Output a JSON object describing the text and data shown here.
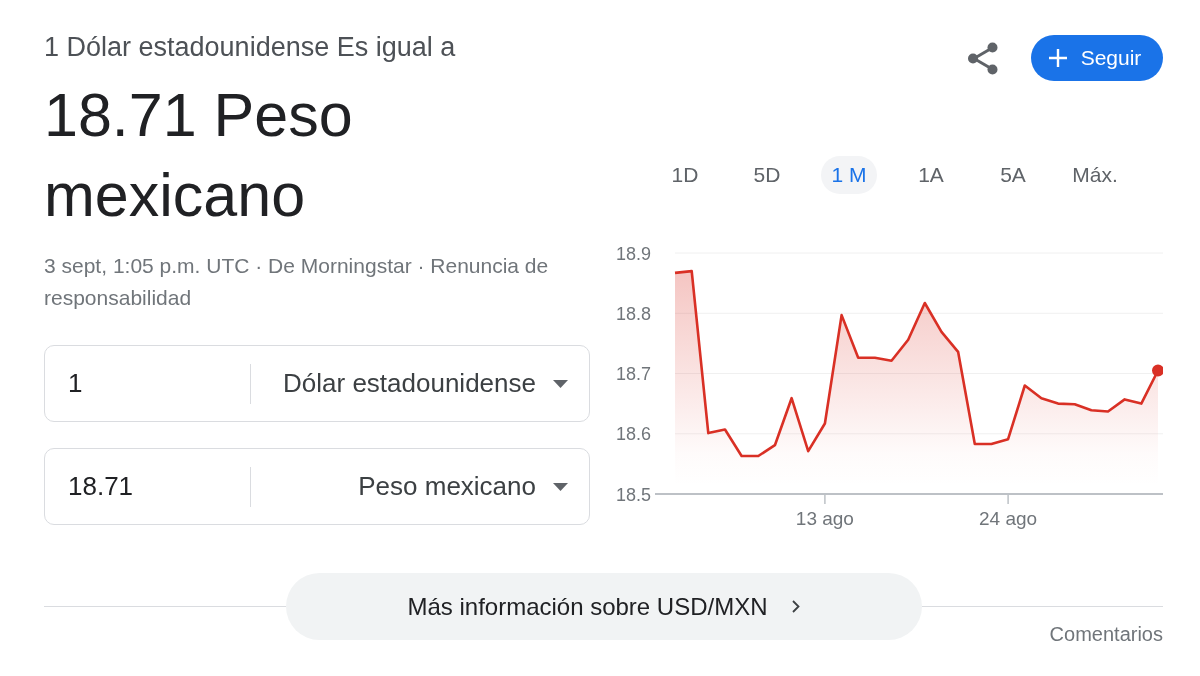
{
  "conversion": {
    "label": "1 Dólar estadounidense Es igual a",
    "result": "18.71 Peso mexicano",
    "note": "3 sept, 1:05 p.m. UTC · De Morningstar · Renuncia de responsabilidad"
  },
  "follow_button": {
    "label": "Seguir"
  },
  "converter": [
    {
      "amount": "1",
      "currency": "Dólar estadounidense"
    },
    {
      "amount": "18.71",
      "currency": "Peso mexicano"
    }
  ],
  "chart": {
    "ranges": [
      {
        "label": "1D",
        "selected": false
      },
      {
        "label": "5D",
        "selected": false
      },
      {
        "label": "1 M",
        "selected": true
      },
      {
        "label": "1A",
        "selected": false
      },
      {
        "label": "5A",
        "selected": false
      },
      {
        "label": "Máx.",
        "selected": false
      }
    ],
    "chart_data": {
      "type": "area",
      "categories": [
        null,
        null,
        null,
        null,
        null,
        null,
        null,
        null,
        null,
        "13 ago",
        null,
        null,
        null,
        null,
        null,
        null,
        null,
        null,
        null,
        null,
        "24 ago",
        null,
        null,
        null,
        null,
        null,
        null,
        null,
        null,
        null
      ],
      "ylim": [
        18.5,
        18.9
      ],
      "yticks": [
        18.5,
        18.6,
        18.7,
        18.8,
        18.9
      ],
      "grid": true,
      "series": [
        {
          "color": "#d93025",
          "values": [
            18.867,
            18.87,
            18.601,
            18.607,
            18.563,
            18.563,
            18.581,
            18.659,
            18.571,
            18.617,
            18.797,
            18.726,
            18.726,
            18.721,
            18.756,
            18.817,
            18.769,
            18.736,
            18.583,
            18.583,
            18.591,
            18.68,
            18.659,
            18.65,
            18.649,
            18.639,
            18.637,
            18.657,
            18.65,
            18.705
          ]
        }
      ]
    }
  },
  "more_info_button": {
    "label": "Más información sobre USD/MXN"
  },
  "feedback_link": "Comentarios"
}
